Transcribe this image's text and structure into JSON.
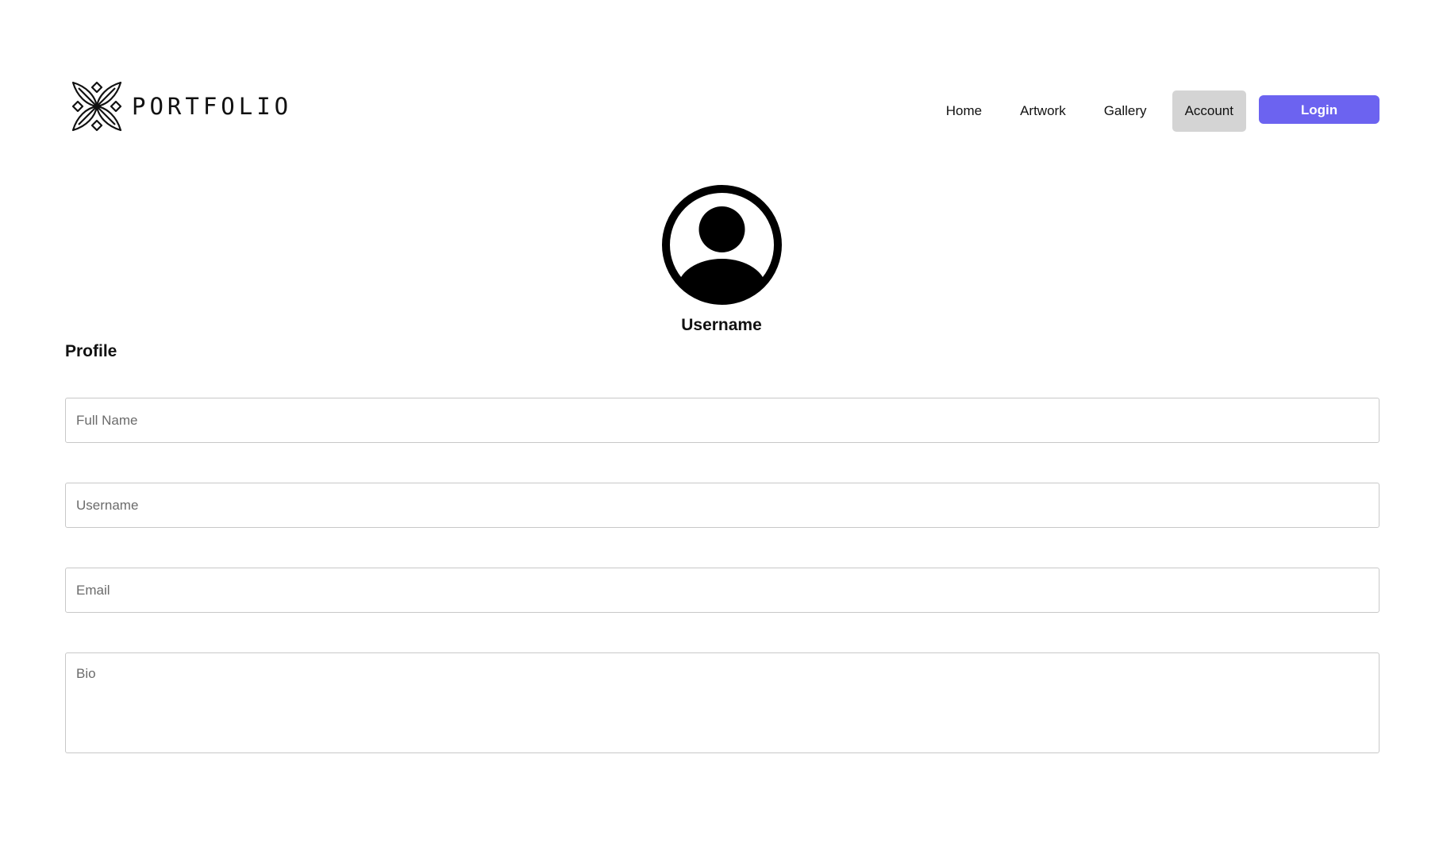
{
  "brand": {
    "name": "PORTFOLIO",
    "logo_icon": "floral-cross-icon"
  },
  "nav": {
    "items": [
      {
        "label": "Home"
      },
      {
        "label": "Artwork"
      },
      {
        "label": "Gallery"
      },
      {
        "label": "Account",
        "active": true
      }
    ],
    "login_label": "Login"
  },
  "profile": {
    "avatar_icon": "user-avatar-icon",
    "username": "Username",
    "section_title": "Profile",
    "fields": {
      "full_name": {
        "placeholder": "Full Name",
        "value": ""
      },
      "username": {
        "placeholder": "Username",
        "value": ""
      },
      "email": {
        "placeholder": "Email",
        "value": ""
      },
      "bio": {
        "placeholder": "Bio",
        "value": ""
      }
    }
  },
  "colors": {
    "accent": "#6c63f0",
    "active_nav_bg": "#d4d4d4",
    "border": "#c8c8c8"
  }
}
